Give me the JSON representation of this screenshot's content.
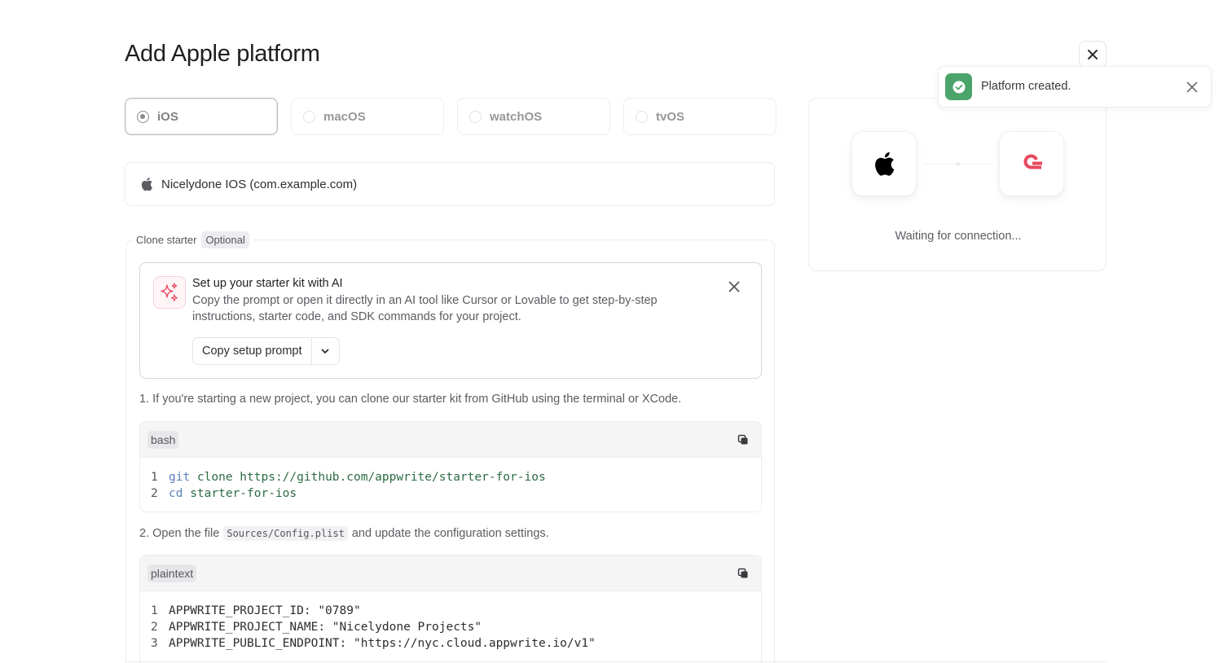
{
  "modal": {
    "title": "Add Apple platform"
  },
  "platform_tabs": [
    {
      "label": "iOS",
      "selected": true
    },
    {
      "label": "macOS",
      "selected": false
    },
    {
      "label": "watchOS",
      "selected": false
    },
    {
      "label": "tvOS",
      "selected": false
    }
  ],
  "app": {
    "name": "Nicelydone IOS (com.example.com)",
    "icon": "apple-icon"
  },
  "clone_starter": {
    "legend": "Clone starter",
    "badge": "Optional",
    "ai_card": {
      "title": "Set up your starter kit with AI",
      "description": "Copy the prompt or open it directly in an AI tool like Cursor or Lovable to get step-by-step instructions, starter code, and SDK commands for your project.",
      "copy_button": "Copy setup prompt",
      "icon": "sparkles-icon"
    },
    "step1": "1. If you're starting a new project, you can clone our starter kit from GitHub using the terminal or XCode.",
    "code1": {
      "lang": "bash",
      "lines": [
        {
          "n": "1",
          "kw": "git",
          "rest": " clone https://github.com/appwrite/starter-for-ios"
        },
        {
          "n": "2",
          "kw": "cd",
          "rest": " starter-for-ios"
        }
      ]
    },
    "step2": {
      "before": "2. Open the file",
      "code": "Sources/Config.plist",
      "after": "and update the configuration settings."
    },
    "code2": {
      "lang": "plaintext",
      "lines": [
        {
          "n": "1",
          "text": "APPWRITE_PROJECT_ID: \"0789\""
        },
        {
          "n": "2",
          "text": "APPWRITE_PROJECT_NAME: \"Nicelydone Projects\""
        },
        {
          "n": "3",
          "text": "APPWRITE_PUBLIC_ENDPOINT: \"https://nyc.cloud.appwrite.io/v1\""
        }
      ]
    }
  },
  "connection": {
    "status": "Waiting for connection..."
  },
  "toast": {
    "message": "Platform created.",
    "color": "#4ba56a"
  },
  "colors": {
    "brand": "#e8485f",
    "success": "#4ba56a"
  }
}
